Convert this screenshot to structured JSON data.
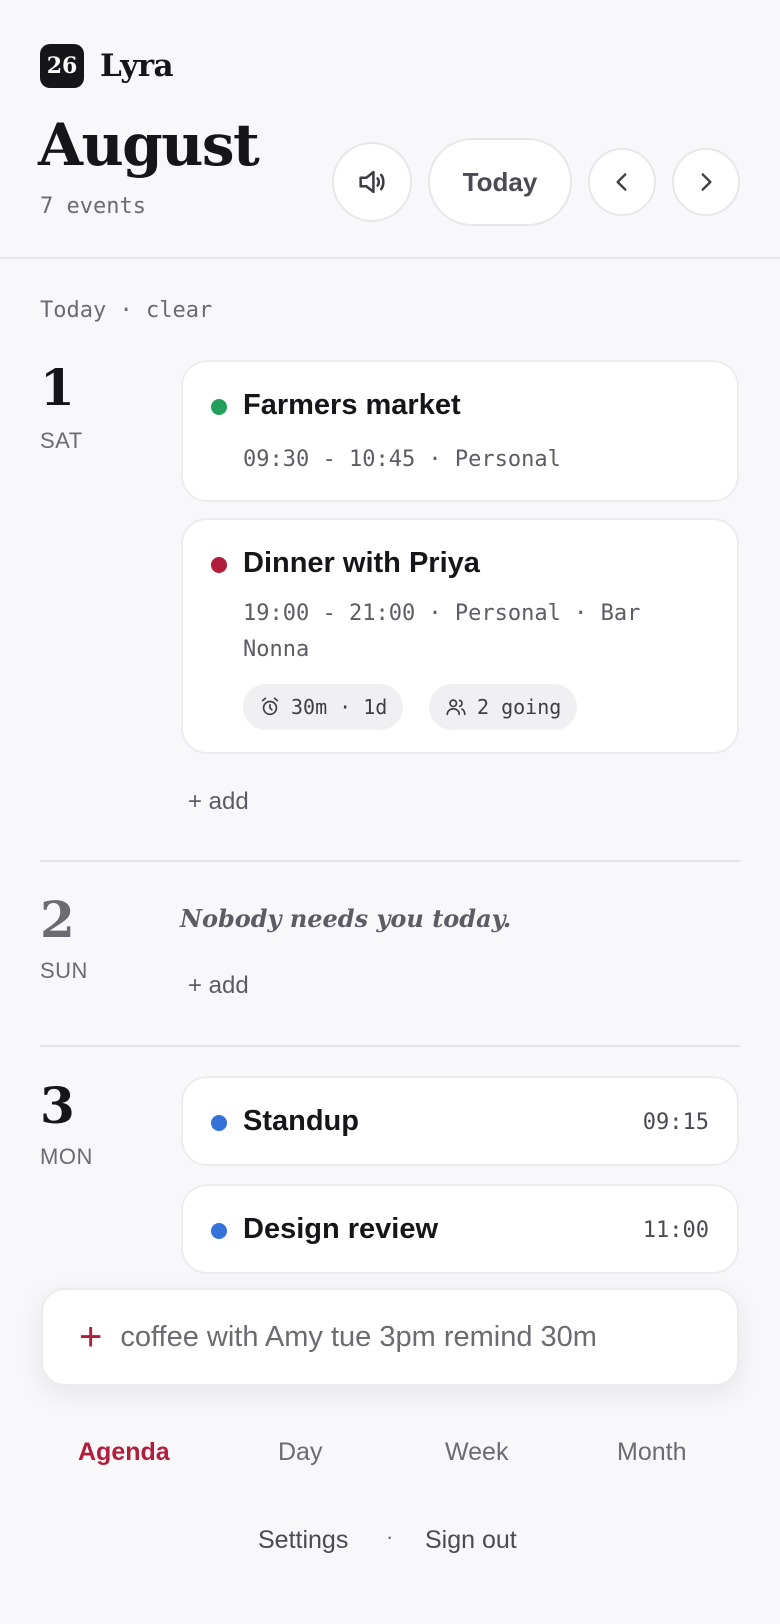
{
  "app": {
    "badge": "26",
    "name": "Lyra"
  },
  "header": {
    "month": "August",
    "event_count": "7 events",
    "today_label": "Today"
  },
  "weather": "Today · clear",
  "days": [
    {
      "num": "1",
      "name": "SAT",
      "events": [
        {
          "title": "Farmers market",
          "meta": "09:30 - 10:45 · Personal",
          "color": "#22a05a"
        },
        {
          "title": "Dinner with Priya",
          "meta": "19:00 - 21:00 · Personal · Bar Nonna",
          "color": "#b11d3a",
          "reminder": "30m · 1d",
          "attendees": "2 going"
        }
      ],
      "add_label": "+ add"
    },
    {
      "num": "2",
      "name": "SUN",
      "empty_note": "Nobody needs you today.",
      "add_label": "+ add"
    },
    {
      "num": "3",
      "name": "MON",
      "events": [
        {
          "title": "Standup",
          "time": "09:15",
          "color": "#3272d9"
        },
        {
          "title": "Design review",
          "time": "11:00",
          "color": "#3272d9"
        }
      ]
    }
  ],
  "quick_add": {
    "placeholder": "coffee with Amy tue 3pm remind 30m",
    "accent": "#b11d3a"
  },
  "tabs": [
    {
      "label": "Agenda",
      "active": true
    },
    {
      "label": "Day",
      "active": false
    },
    {
      "label": "Week",
      "active": false
    },
    {
      "label": "Month",
      "active": false
    }
  ],
  "footer": {
    "settings": "Settings",
    "separator": "·",
    "sign_out": "Sign out"
  },
  "icons": [
    "speaker-icon",
    "chevron-left-icon",
    "chevron-right-icon",
    "alarm-icon",
    "people-icon",
    "plus-icon"
  ]
}
